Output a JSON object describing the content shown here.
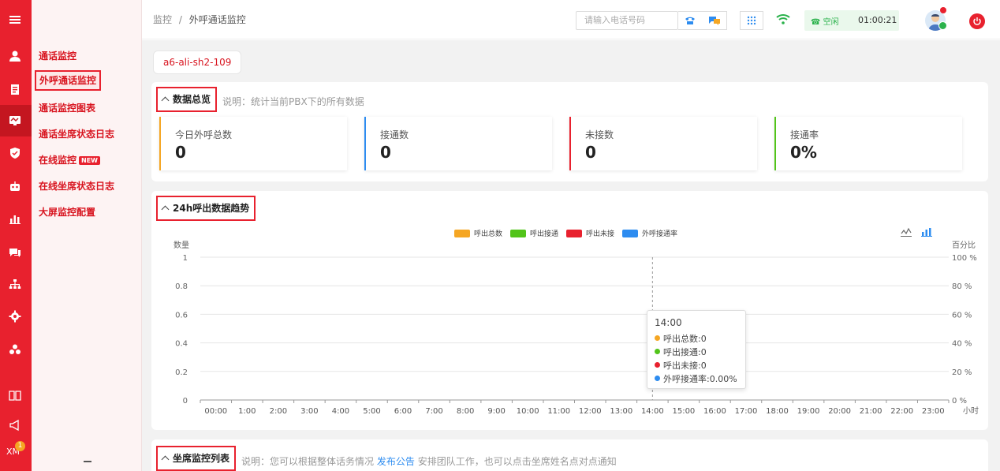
{
  "rail": {
    "icons": [
      "menu-icon",
      "user-icon",
      "clipboard-icon",
      "monitor-icon",
      "shield-icon",
      "robot-icon",
      "bar-chart-icon",
      "chat-icon",
      "org-tree-icon",
      "gear-icon",
      "cluster-icon",
      "book-icon",
      "megaphone-icon"
    ],
    "xm_label": "XM",
    "xm_badge": "1"
  },
  "submenu": {
    "items": [
      {
        "label": "通话监控"
      },
      {
        "label": "外呼通话监控"
      },
      {
        "label": "通话监控图表"
      },
      {
        "label": "通话坐席状态日志"
      },
      {
        "label": "在线监控",
        "badge": "NEW"
      },
      {
        "label": "在线坐席状态日志"
      },
      {
        "label": "大屏监控配置"
      }
    ]
  },
  "header": {
    "breadcrumb_root": "监控",
    "breadcrumb_sep": "/",
    "breadcrumb_current": "外呼通话监控",
    "search_placeholder": "请输入电话号码",
    "status_label": "空闲",
    "timer": "01:00:21"
  },
  "main": {
    "server_tag": "a6-ali-sh2-109",
    "overview": {
      "title": "数据总览",
      "note": "说明：统计当前PBX下的所有数据",
      "stats": [
        {
          "label": "今日外呼总数",
          "value": "0",
          "color": "#f5a623"
        },
        {
          "label": "接通数",
          "value": "0",
          "color": "#2d8cf0"
        },
        {
          "label": "未接数",
          "value": "0",
          "color": "#e8212e"
        },
        {
          "label": "接通率",
          "value": "0%",
          "color": "#52c41a"
        }
      ]
    },
    "trend": {
      "title": "24h呼出数据趋势"
    },
    "agent_list": {
      "title": "坐席监控列表",
      "note_before": "说明：您可以根据整体话务情况",
      "note_link": "发布公告",
      "note_after": "安排团队工作，也可以点击坐席姓名点对点通知"
    }
  },
  "chart_data": {
    "type": "bar",
    "y_left_label": "数量",
    "y_right_label": "百分比",
    "x_unit_label": "小时",
    "categories": [
      "00:00",
      "1:00",
      "2:00",
      "3:00",
      "4:00",
      "5:00",
      "6:00",
      "7:00",
      "8:00",
      "9:00",
      "10:00",
      "11:00",
      "12:00",
      "13:00",
      "14:00",
      "15:00",
      "16:00",
      "17:00",
      "18:00",
      "19:00",
      "20:00",
      "21:00",
      "22:00",
      "23:00"
    ],
    "y_left_ticks": [
      "0",
      "0.2",
      "0.4",
      "0.6",
      "0.8",
      "1"
    ],
    "y_right_ticks": [
      "0 %",
      "20 %",
      "40 %",
      "60 %",
      "80 %",
      "100 %"
    ],
    "ylim": [
      0,
      1
    ],
    "y2lim": [
      0,
      100
    ],
    "grid": true,
    "legend_position": "top-center",
    "series": [
      {
        "name": "呼出总数",
        "color": "#f5a623",
        "values": [
          0,
          0,
          0,
          0,
          0,
          0,
          0,
          0,
          0,
          0,
          0,
          0,
          0,
          0,
          0,
          0,
          0,
          0,
          0,
          0,
          0,
          0,
          0,
          0
        ]
      },
      {
        "name": "呼出接通",
        "color": "#52c41a",
        "values": [
          0,
          0,
          0,
          0,
          0,
          0,
          0,
          0,
          0,
          0,
          0,
          0,
          0,
          0,
          0,
          0,
          0,
          0,
          0,
          0,
          0,
          0,
          0,
          0
        ]
      },
      {
        "name": "呼出未接",
        "color": "#e8212e",
        "values": [
          0,
          0,
          0,
          0,
          0,
          0,
          0,
          0,
          0,
          0,
          0,
          0,
          0,
          0,
          0,
          0,
          0,
          0,
          0,
          0,
          0,
          0,
          0,
          0
        ]
      },
      {
        "name": "外呼接通率",
        "color": "#2d8cf0",
        "values": [
          0,
          0,
          0,
          0,
          0,
          0,
          0,
          0,
          0,
          0,
          0,
          0,
          0,
          0,
          0,
          0,
          0,
          0,
          0,
          0,
          0,
          0,
          0,
          0
        ]
      }
    ],
    "tooltip": {
      "time": "14:00",
      "rows": [
        "呼出总数:0",
        "呼出接通:0",
        "呼出未接:0",
        "外呼接通率:0.00%"
      ]
    }
  }
}
